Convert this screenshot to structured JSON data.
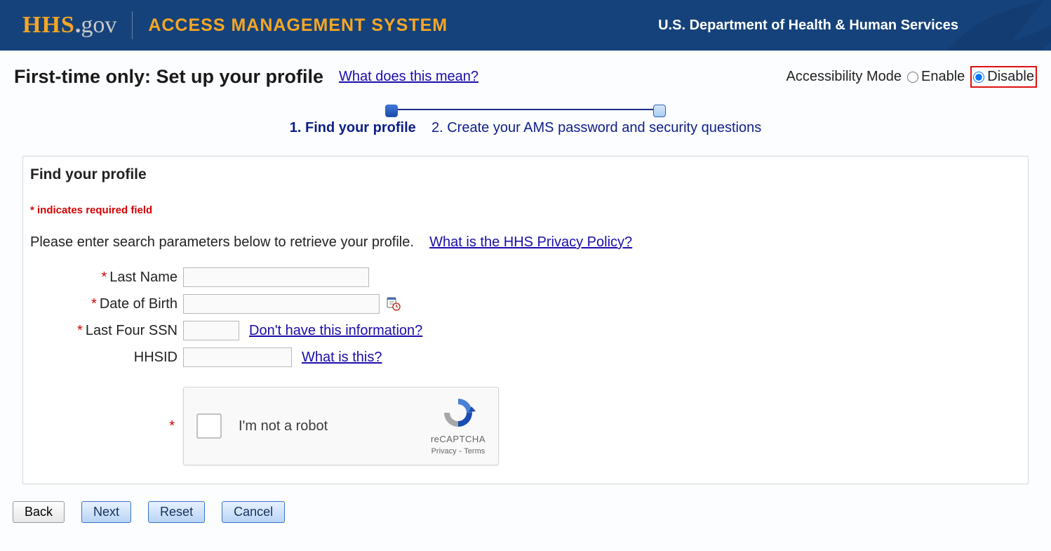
{
  "header": {
    "logo_hhs": "HHS",
    "logo_dot": ".",
    "logo_gov": "gov",
    "system_title": "ACCESS MANAGEMENT SYSTEM",
    "department": "U.S. Department of Health & Human Services"
  },
  "page": {
    "title": "First-time only: Set up your profile",
    "help_link": "What does this mean?"
  },
  "accessibility": {
    "label": "Accessibility Mode",
    "enable": "Enable",
    "disable": "Disable",
    "selected": "disable"
  },
  "progress": {
    "step1": "1. Find your profile",
    "step2": "2. Create your AMS password and security questions"
  },
  "panel": {
    "title": "Find your profile",
    "required_note": "* indicates required field",
    "instruction": "Please enter search parameters below to retrieve your profile.",
    "privacy_link": "What is the HHS Privacy Policy?"
  },
  "form": {
    "last_name": {
      "label": "Last Name",
      "required": true,
      "value": ""
    },
    "dob": {
      "label": "Date of Birth",
      "required": true,
      "value": ""
    },
    "ssn": {
      "label": "Last Four SSN",
      "required": true,
      "value": "",
      "help": "Don't have this information?"
    },
    "hhsid": {
      "label": "HHSID",
      "required": false,
      "value": "",
      "help": "What is this?"
    }
  },
  "captcha": {
    "label": "I'm not a robot",
    "brand": "reCAPTCHA",
    "privacy": "Privacy",
    "terms": "Terms",
    "sep": " - "
  },
  "buttons": {
    "back": "Back",
    "next": "Next",
    "reset": "Reset",
    "cancel": "Cancel"
  }
}
